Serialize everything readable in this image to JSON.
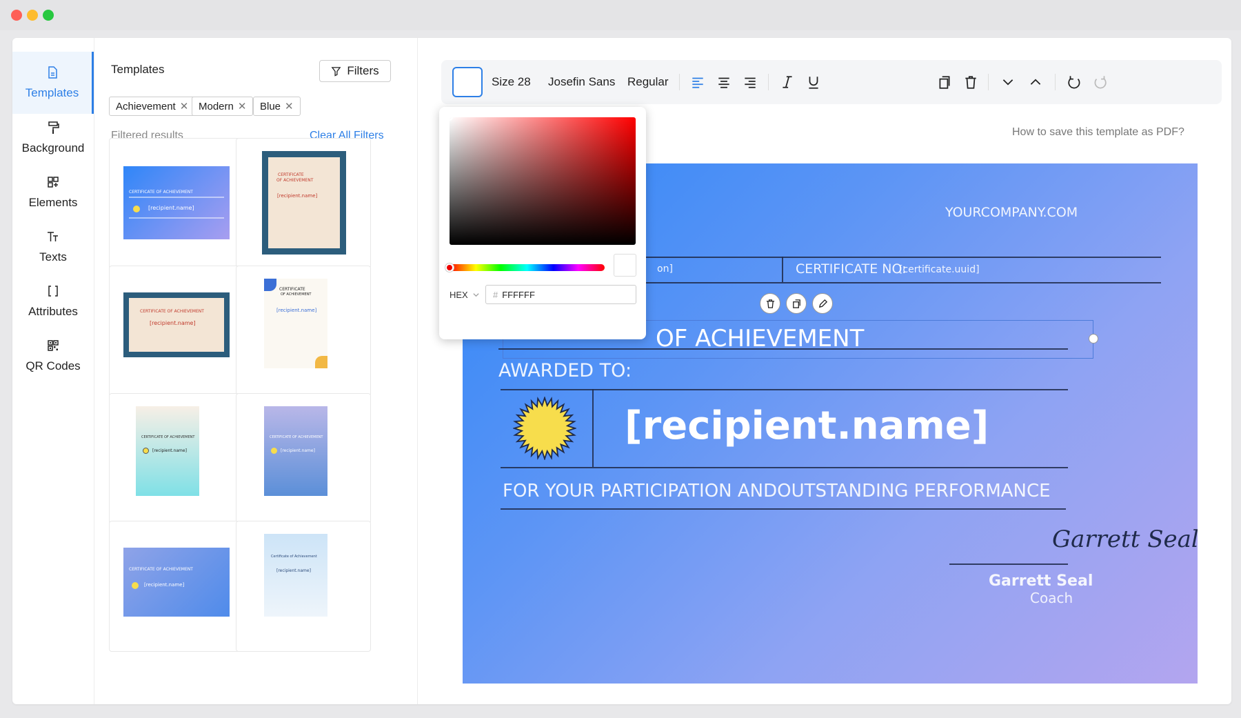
{
  "sidebar": {
    "items": [
      {
        "label": "Templates",
        "icon": "document-icon",
        "active": true
      },
      {
        "label": "Background",
        "icon": "paint-roller-icon"
      },
      {
        "label": "Elements",
        "icon": "shapes-icon"
      },
      {
        "label": "Texts",
        "icon": "text-icon"
      },
      {
        "label": "Attributes",
        "icon": "brackets-icon"
      },
      {
        "label": "QR Codes",
        "icon": "qr-code-icon"
      }
    ]
  },
  "panel": {
    "title": "Templates",
    "filters_label": "Filters",
    "chips": [
      "Achievement",
      "Modern",
      "Blue"
    ],
    "filtered_label": "Filtered results",
    "clear_all": "Clear All Filters"
  },
  "thumbs": {
    "t1": {
      "title": "CERTIFICATE OF ACHIEVEMENT",
      "name": "[recipient.name]"
    },
    "t2": {
      "title": "CERTIFICATE",
      "subtitle": "OF ACHIEVEMENT",
      "name": "[recipient.name]"
    },
    "t3": {
      "title": "CERTIFICATE OF ACHIEVEMENT",
      "name": "[recipient.name]"
    },
    "t4": {
      "title": "CERTIFICATE",
      "subtitle": "OF ACHIEVEMENT",
      "name": "[recipient.name]"
    },
    "t5": {
      "title": "CERTIFICATE OF ACHIEVEMENT",
      "name": "[recipient.name]"
    },
    "t6": {
      "title": "CERTIFICATE OF ACHIEVEMENT",
      "name": "[recipient.name]"
    },
    "t7": {
      "title": "CERTIFICATE OF ACHIEVEMENT",
      "name": "[recipient.name]"
    },
    "t8": {
      "title": "Certificate of Achievement",
      "name": "[recipient.name]"
    }
  },
  "toolbar": {
    "size": "Size 28",
    "font": "Josefin Sans",
    "weight": "Regular"
  },
  "save_hint": "How to save this template as PDF?",
  "picker": {
    "mode": "HEX",
    "hash": "#",
    "hex_value": "FFFFFF"
  },
  "certificate": {
    "website": "YOURCOMPANY.COM",
    "left_field_fragment": "on]",
    "cert_no": "CERTIFICATE NO:",
    "cert_no_value": "[certificate.uuid]",
    "title_fragment": "OF ACHIEVEMENT",
    "awarded_to": "AWARDED TO:",
    "recipient": "[recipient.name]",
    "reason": "FOR YOUR PARTICIPATION ANDOUTSTANDING PERFORMANCE",
    "signature": "Garrett Seal",
    "signer_name": "Garrett Seal",
    "signer_title": "Coach"
  },
  "colors": {
    "accent": "#2d7fe6",
    "cert_gradient_start": "#2f86f8",
    "cert_gradient_end": "#b3a5ef",
    "seal": "#f7dd4c"
  }
}
